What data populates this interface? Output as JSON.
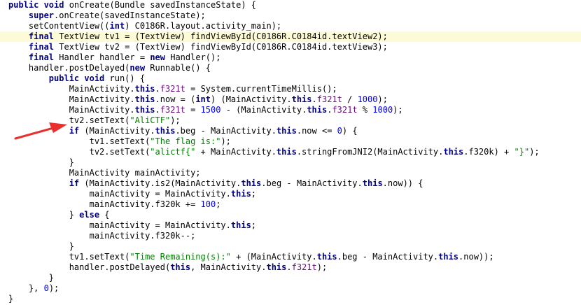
{
  "colors": {
    "keyword": "#000080",
    "string": "#008000",
    "field": "#660e7a",
    "number": "#0000ff",
    "plain": "#000000",
    "highlight_bg": "#fcfbd6",
    "arrow": "#e8312f"
  },
  "annotation_icon": "red-arrow-icon",
  "code": {
    "lines": [
      {
        "highlight": false,
        "tokens": [
          [
            "kw",
            "public void "
          ],
          [
            "pl",
            "onCreate(Bundle savedInstanceState) {"
          ]
        ]
      },
      {
        "highlight": false,
        "tokens": [
          [
            "pl",
            "    "
          ],
          [
            "kw",
            "super"
          ],
          [
            "pl",
            ".onCreate(savedInstanceState);"
          ]
        ]
      },
      {
        "highlight": false,
        "tokens": [
          [
            "pl",
            "    setContentView(("
          ],
          [
            "kw",
            "int"
          ],
          [
            "pl",
            ") C0186R.layout.activity_main);"
          ]
        ]
      },
      {
        "highlight": true,
        "tokens": [
          [
            "pl",
            "    "
          ],
          [
            "kw",
            "final "
          ],
          [
            "pl",
            "TextView tv1 = (TextView) findViewById(C0186R.C0184id.textView2);"
          ]
        ]
      },
      {
        "highlight": false,
        "tokens": [
          [
            "pl",
            "    "
          ],
          [
            "kw",
            "final "
          ],
          [
            "pl",
            "TextView tv2 = (TextView) findViewById(C0186R.C0184id.textView3);"
          ]
        ]
      },
      {
        "highlight": false,
        "tokens": [
          [
            "pl",
            "    "
          ],
          [
            "kw",
            "final "
          ],
          [
            "pl",
            "Handler handler = "
          ],
          [
            "kw",
            "new "
          ],
          [
            "pl",
            "Handler();"
          ]
        ]
      },
      {
        "highlight": false,
        "tokens": [
          [
            "pl",
            "    handler.postDelayed("
          ],
          [
            "kw",
            "new "
          ],
          [
            "pl",
            "Runnable() {"
          ]
        ]
      },
      {
        "highlight": false,
        "tokens": [
          [
            "pl",
            "        "
          ],
          [
            "kw",
            "public void "
          ],
          [
            "pl",
            "run() {"
          ]
        ]
      },
      {
        "highlight": false,
        "tokens": [
          [
            "pl",
            "            MainActivity."
          ],
          [
            "kw",
            "this"
          ],
          [
            "pl",
            "."
          ],
          [
            "fld",
            "f321t"
          ],
          [
            "pl",
            " = System.currentTimeMillis();"
          ]
        ]
      },
      {
        "highlight": false,
        "tokens": [
          [
            "pl",
            "            MainActivity."
          ],
          [
            "kw",
            "this"
          ],
          [
            "pl",
            ".now = ("
          ],
          [
            "kw",
            "int"
          ],
          [
            "pl",
            ") (MainActivity."
          ],
          [
            "kw",
            "this"
          ],
          [
            "pl",
            "."
          ],
          [
            "fld",
            "f321t"
          ],
          [
            "pl",
            " / "
          ],
          [
            "num",
            "1000"
          ],
          [
            "pl",
            ");"
          ]
        ]
      },
      {
        "highlight": false,
        "tokens": [
          [
            "pl",
            "            MainActivity."
          ],
          [
            "kw",
            "this"
          ],
          [
            "pl",
            "."
          ],
          [
            "fld",
            "f321t"
          ],
          [
            "pl",
            " = "
          ],
          [
            "num",
            "1500"
          ],
          [
            "pl",
            " - (MainActivity."
          ],
          [
            "kw",
            "this"
          ],
          [
            "pl",
            "."
          ],
          [
            "fld",
            "f321t"
          ],
          [
            "pl",
            " % "
          ],
          [
            "num",
            "1000"
          ],
          [
            "pl",
            ");"
          ]
        ]
      },
      {
        "highlight": false,
        "tokens": [
          [
            "pl",
            "            tv2.setText("
          ],
          [
            "str",
            "\"AliCTF\""
          ],
          [
            "pl",
            ");"
          ]
        ]
      },
      {
        "highlight": false,
        "tokens": [
          [
            "pl",
            "            "
          ],
          [
            "kw",
            "if "
          ],
          [
            "pl",
            "(MainActivity."
          ],
          [
            "kw",
            "this"
          ],
          [
            "pl",
            ".beg - MainActivity."
          ],
          [
            "kw",
            "this"
          ],
          [
            "pl",
            ".now <= "
          ],
          [
            "num",
            "0"
          ],
          [
            "pl",
            ") {"
          ]
        ]
      },
      {
        "highlight": false,
        "tokens": [
          [
            "pl",
            "                tv1.setText("
          ],
          [
            "str",
            "\"The flag is:\""
          ],
          [
            "pl",
            ");"
          ]
        ]
      },
      {
        "highlight": false,
        "tokens": [
          [
            "pl",
            "                tv2.setText("
          ],
          [
            "str",
            "\"alictf{\""
          ],
          [
            "pl",
            " + MainActivity."
          ],
          [
            "kw",
            "this"
          ],
          [
            "pl",
            ".stringFromJNI2(MainActivity."
          ],
          [
            "kw",
            "this"
          ],
          [
            "pl",
            ".f320k) + "
          ],
          [
            "str",
            "\"}\""
          ],
          [
            "pl",
            ");"
          ]
        ]
      },
      {
        "highlight": false,
        "tokens": [
          [
            "pl",
            "            }"
          ]
        ]
      },
      {
        "highlight": false,
        "tokens": [
          [
            "pl",
            "            MainActivity mainActivity;"
          ]
        ]
      },
      {
        "highlight": false,
        "tokens": [
          [
            "pl",
            "            "
          ],
          [
            "kw",
            "if "
          ],
          [
            "pl",
            "(MainActivity.is2(MainActivity."
          ],
          [
            "kw",
            "this"
          ],
          [
            "pl",
            ".beg - MainActivity."
          ],
          [
            "kw",
            "this"
          ],
          [
            "pl",
            ".now)) {"
          ]
        ]
      },
      {
        "highlight": false,
        "tokens": [
          [
            "pl",
            "                mainActivity = MainActivity."
          ],
          [
            "kw",
            "this"
          ],
          [
            "pl",
            ";"
          ]
        ]
      },
      {
        "highlight": false,
        "tokens": [
          [
            "pl",
            "                mainActivity.f320k += "
          ],
          [
            "num",
            "100"
          ],
          [
            "pl",
            ";"
          ]
        ]
      },
      {
        "highlight": false,
        "tokens": [
          [
            "pl",
            "            } "
          ],
          [
            "kw",
            "else "
          ],
          [
            "pl",
            "{"
          ]
        ]
      },
      {
        "highlight": false,
        "tokens": [
          [
            "pl",
            "                mainActivity = MainActivity."
          ],
          [
            "kw",
            "this"
          ],
          [
            "pl",
            ";"
          ]
        ]
      },
      {
        "highlight": false,
        "tokens": [
          [
            "pl",
            "                mainActivity.f320k--;"
          ]
        ]
      },
      {
        "highlight": false,
        "tokens": [
          [
            "pl",
            "            }"
          ]
        ]
      },
      {
        "highlight": false,
        "tokens": [
          [
            "pl",
            "            tv1.setText("
          ],
          [
            "str",
            "\"Time Remaining(s):\""
          ],
          [
            "pl",
            " + (MainActivity."
          ],
          [
            "kw",
            "this"
          ],
          [
            "pl",
            ".beg - MainActivity."
          ],
          [
            "kw",
            "this"
          ],
          [
            "pl",
            ".now));"
          ]
        ]
      },
      {
        "highlight": false,
        "tokens": [
          [
            "pl",
            "            handler.postDelayed("
          ],
          [
            "kw",
            "this"
          ],
          [
            "pl",
            ", MainActivity."
          ],
          [
            "kw",
            "this"
          ],
          [
            "pl",
            "."
          ],
          [
            "fld",
            "f321t"
          ],
          [
            "pl",
            ");"
          ]
        ]
      },
      {
        "highlight": false,
        "tokens": [
          [
            "pl",
            "        }"
          ]
        ]
      },
      {
        "highlight": false,
        "tokens": [
          [
            "pl",
            "    }, "
          ],
          [
            "num",
            "0"
          ],
          [
            "pl",
            ");"
          ]
        ]
      },
      {
        "highlight": false,
        "tokens": [
          [
            "pl",
            "}"
          ]
        ]
      }
    ]
  }
}
